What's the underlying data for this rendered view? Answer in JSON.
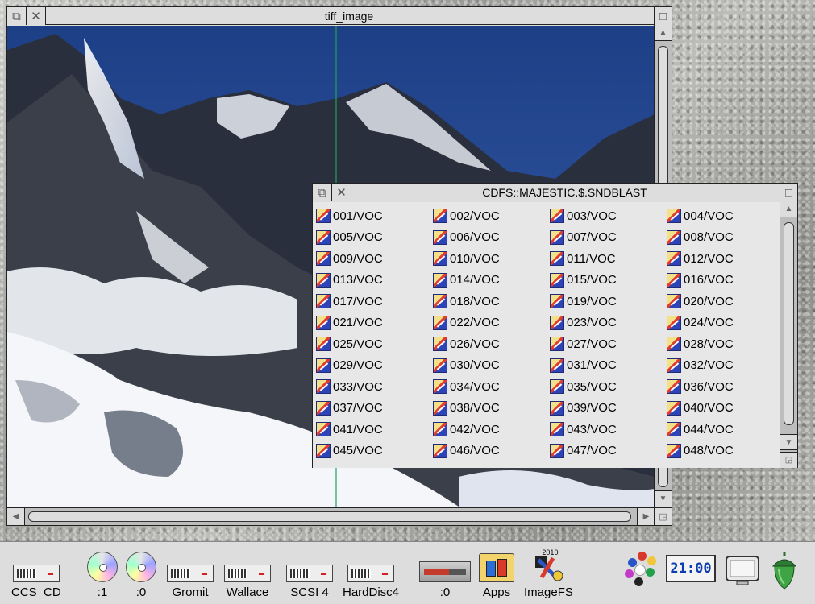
{
  "tiff_window": {
    "title": "tiff_image",
    "back_icon": "back-icon",
    "close_icon": "close-icon",
    "toggle_icon": "toggle-size-icon",
    "image_description_icon": "mountain-photo"
  },
  "filer_window": {
    "title": "CDFS::MAJESTIC.$.SNDBLAST",
    "files": [
      "001/VOC",
      "002/VOC",
      "003/VOC",
      "004/VOC",
      "005/VOC",
      "006/VOC",
      "007/VOC",
      "008/VOC",
      "009/VOC",
      "010/VOC",
      "011/VOC",
      "012/VOC",
      "013/VOC",
      "014/VOC",
      "015/VOC",
      "016/VOC",
      "017/VOC",
      "018/VOC",
      "019/VOC",
      "020/VOC",
      "021/VOC",
      "022/VOC",
      "023/VOC",
      "024/VOC",
      "025/VOC",
      "026/VOC",
      "027/VOC",
      "028/VOC",
      "029/VOC",
      "030/VOC",
      "031/VOC",
      "032/VOC",
      "033/VOC",
      "034/VOC",
      "035/VOC",
      "036/VOC",
      "037/VOC",
      "038/VOC",
      "039/VOC",
      "040/VOC",
      "041/VOC",
      "042/VOC",
      "043/VOC",
      "044/VOC",
      "045/VOC",
      "046/VOC",
      "047/VOC",
      "048/VOC"
    ],
    "file_icon": "sound-file-icon"
  },
  "iconbar": {
    "items": [
      {
        "label": "CCS_CD",
        "icon": "drive-icon"
      },
      {
        "label": ":1",
        "icon": "cd-icon"
      },
      {
        "label": ":0",
        "icon": "cd-icon"
      },
      {
        "label": "Gromit",
        "icon": "drive-icon"
      },
      {
        "label": "Wallace",
        "icon": "drive-icon"
      },
      {
        "label": "SCSI 4",
        "icon": "drive-icon"
      },
      {
        "label": "HardDisc4",
        "icon": "drive-icon"
      },
      {
        "label": ":0",
        "icon": "ram-disc-icon"
      },
      {
        "label": "Apps",
        "icon": "apps-icon"
      },
      {
        "label": "ImageFS",
        "icon": "imagefs-icon"
      }
    ],
    "imagefs_tag": "2010",
    "clock": "21:00",
    "palette_icon": "palette-icon",
    "monitor_icon": "display-icon",
    "acorn_icon": "acorn-icon"
  },
  "colors": {
    "window_bg": "#dddddd",
    "clock_text": "#0b3cb0"
  }
}
